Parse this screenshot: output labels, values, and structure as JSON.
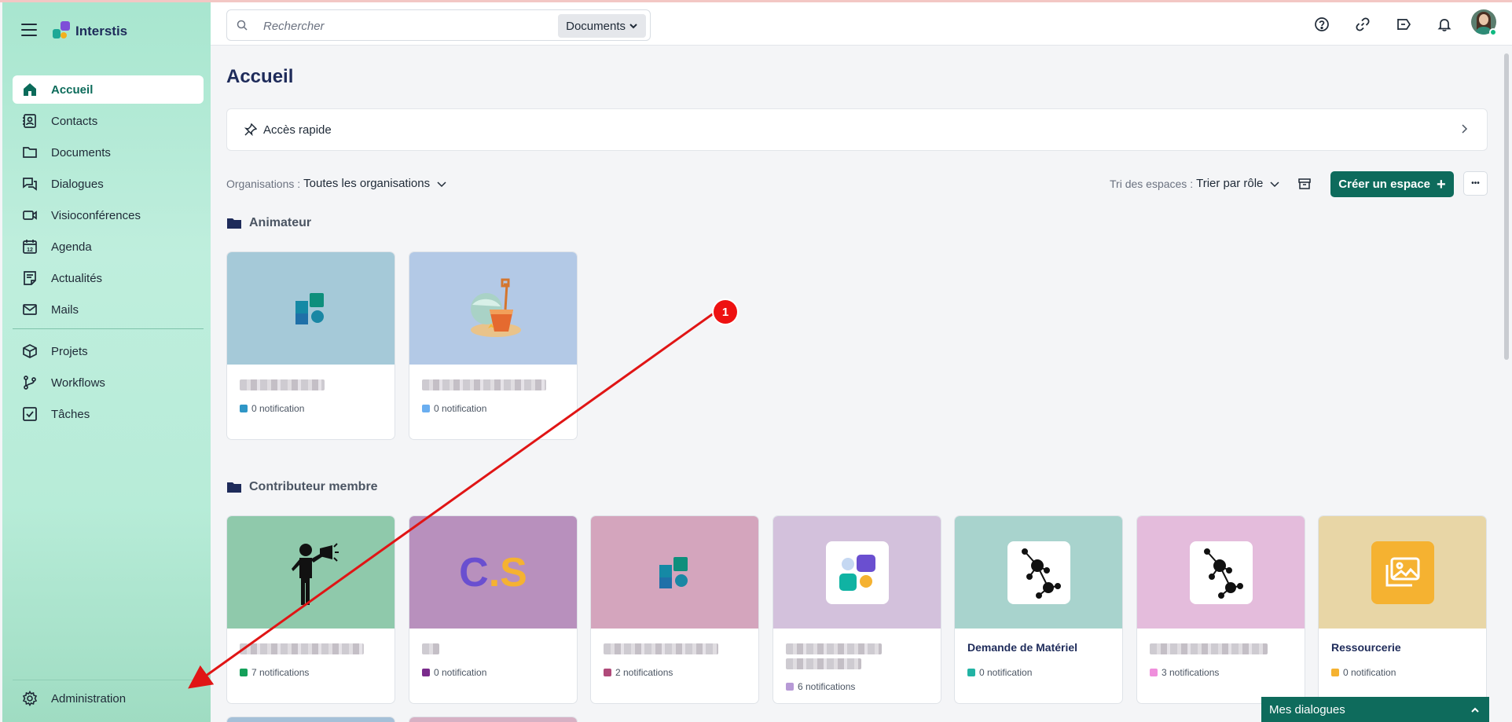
{
  "app": {
    "brand": "Interstis"
  },
  "sidebar": {
    "items": [
      {
        "label": "Accueil",
        "icon": "home-icon",
        "active": true
      },
      {
        "label": "Contacts",
        "icon": "contacts-icon"
      },
      {
        "label": "Documents",
        "icon": "folder-icon"
      },
      {
        "label": "Dialogues",
        "icon": "chat-icon"
      },
      {
        "label": "Visioconférences",
        "icon": "video-icon"
      },
      {
        "label": "Agenda",
        "icon": "calendar-icon"
      },
      {
        "label": "Actualités",
        "icon": "news-icon"
      },
      {
        "label": "Mails",
        "icon": "mail-icon"
      }
    ],
    "items2": [
      {
        "label": "Projets",
        "icon": "cube-icon"
      },
      {
        "label": "Workflows",
        "icon": "workflow-icon"
      },
      {
        "label": "Tâches",
        "icon": "checkbox-icon"
      }
    ],
    "admin": "Administration",
    "calendar_day": "12"
  },
  "topbar": {
    "search_placeholder": "Rechercher",
    "search_scope": "Documents"
  },
  "main": {
    "title": "Accueil",
    "quick_access": "Accès rapide",
    "org_filter_label": "Organisations :",
    "org_filter_value": "Toutes les organisations",
    "sort_label": "Tri des espaces :",
    "sort_value": "Trier par rôle",
    "create_button": "Créer un espace",
    "more_button": "•••",
    "sections": [
      {
        "title": "Animateur",
        "cards": [
          {
            "notifications": "0 notification",
            "dot_color": "#2f96c6",
            "bg": "#a5c9d8"
          },
          {
            "notifications": "0 notification",
            "dot_color": "#6aaef0",
            "bg": "#b3c9e6"
          }
        ]
      },
      {
        "title": "Contributeur membre",
        "cards": [
          {
            "notifications": "7 notifications",
            "dot_color": "#14a05a",
            "bg": "#8fc9ab"
          },
          {
            "notifications": "0 notification",
            "dot_color": "#7a2b8c",
            "bg": "#b890bd",
            "logo": "C.S"
          },
          {
            "notifications": "2 notifications",
            "dot_color": "#b04a7a",
            "bg": "#d4a5bd"
          },
          {
            "notifications": "6 notifications",
            "dot_color": "#b79ad6",
            "bg": "#d3c1dc"
          },
          {
            "name": "Demande de Matériel",
            "notifications": "0 notification",
            "dot_color": "#22b3a4",
            "bg": "#a8d3cd"
          },
          {
            "notifications": "3 notifications",
            "dot_color": "#ef8fdc",
            "bg": "#e4bcdc"
          },
          {
            "name": "Ressourcerie",
            "notifications": "0 notification",
            "dot_color": "#f5b230",
            "bg": "#e8d6a6"
          }
        ]
      }
    ]
  },
  "chat_bar": {
    "label": "Mes dialogues"
  },
  "annotation": {
    "badge": "1",
    "color": "#e01515"
  }
}
